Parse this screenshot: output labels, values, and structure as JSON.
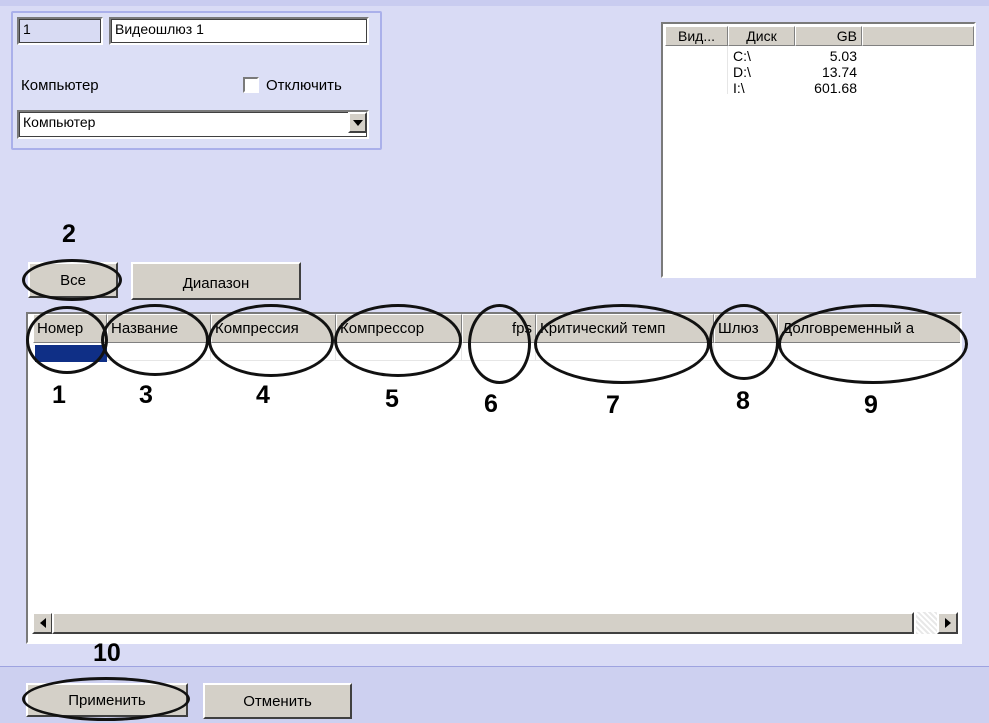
{
  "form": {
    "id_value": "1",
    "name_value": "Видеошлюз 1",
    "computer_label": "Компьютер",
    "disable_label": "Отключить",
    "disable_checked": false,
    "computer_select_value": "Компьютер"
  },
  "disk_table": {
    "headers": [
      "Вид...",
      "Диск",
      "GB"
    ],
    "rows": [
      {
        "drive": "C:\\",
        "gb": "5.03"
      },
      {
        "drive": "D:\\",
        "gb": "13.74"
      },
      {
        "drive": "I:\\",
        "gb": "601.68"
      }
    ]
  },
  "buttons": {
    "all": "Все",
    "range": "Диапазон",
    "apply": "Применить",
    "cancel": "Отменить"
  },
  "grid": {
    "columns": [
      "Номер",
      "Название",
      "Компрессия",
      "Компрессор",
      "fps",
      "Критический темп",
      "Шлюз",
      "Долговременный а"
    ]
  },
  "annotations": [
    "1",
    "2",
    "3",
    "4",
    "5",
    "6",
    "7",
    "8",
    "9",
    "10"
  ],
  "colors": {
    "background": "#d9dbf5",
    "selection": "#0f2f86",
    "annotation": "#111111"
  }
}
